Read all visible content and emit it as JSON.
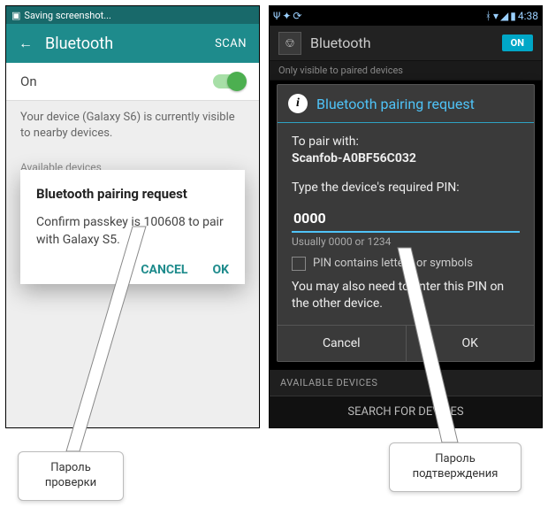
{
  "left": {
    "status_text": "Saving screenshot...",
    "back_icon": "←",
    "title": "Bluetooth",
    "scan_label": "SCAN",
    "on_label": "On",
    "visibility_text": "Your device (Galaxy S6) is currently visible to nearby devices.",
    "available_label": "Available devices",
    "dialog": {
      "title": "Bluetooth pairing request",
      "message": "Confirm passkey is 100608 to pair with Galaxy S5.",
      "cancel": "CANCEL",
      "ok": "OK"
    }
  },
  "right": {
    "time": "4:38",
    "bt_glyph": "⎊",
    "title": "Bluetooth",
    "on_button": "ON",
    "strip_text": "Only visible to paired devices",
    "dialog": {
      "title": "Bluetooth pairing request",
      "pair_label": "To pair with:",
      "device": "Scanfob-A0BF56C032",
      "pin_prompt": "Type the device's required PIN:",
      "pin_value": "0000",
      "hint": "Usually 0000 or 1234",
      "checkbox": "PIN contains letters or symbols",
      "advice": "You may also need to enter this PIN on the other device.",
      "cancel": "Cancel",
      "ok": "OK"
    },
    "available_label": "AVAILABLE DEVICES",
    "search_label": "SEARCH FOR DEVICES"
  },
  "callouts": {
    "left": "Пароль проверки",
    "right": "Пароль подтверждения"
  }
}
